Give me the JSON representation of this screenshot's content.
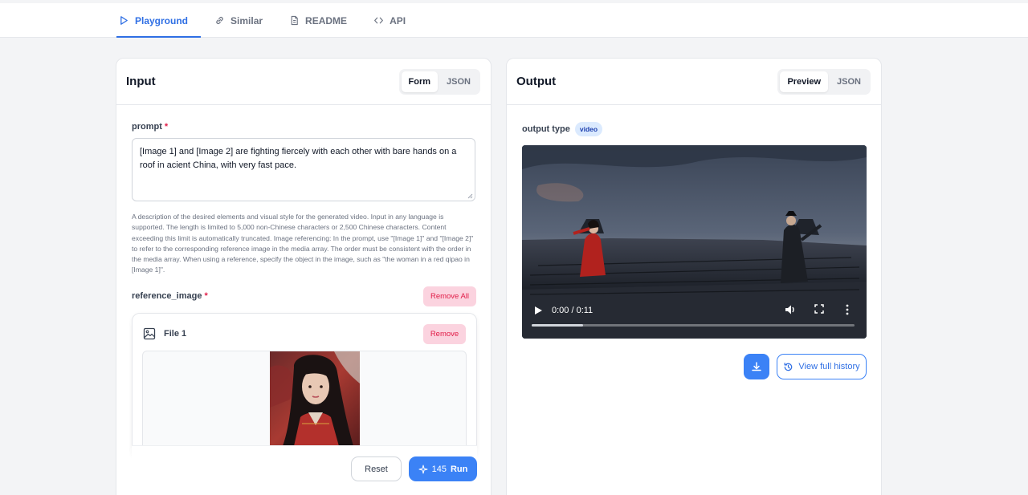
{
  "nav": {
    "tabs": [
      {
        "label": "Playground",
        "icon": "play-icon",
        "active": true
      },
      {
        "label": "Similar",
        "icon": "link-icon"
      },
      {
        "label": "README",
        "icon": "document-icon"
      },
      {
        "label": "API",
        "icon": "code-icon"
      }
    ]
  },
  "input": {
    "title": "Input",
    "toggle": [
      "Form",
      "JSON"
    ],
    "prompt": {
      "label": "prompt",
      "required_mark": "*",
      "value": "[Image 1] and [Image 2] are fighting fiercely with each other with bare hands on a roof in acient China, with very fast pace.",
      "help": "A description of the desired elements and visual style for the generated video. Input in any language is supported. The length is limited to 5,000 non-Chinese characters or 2,500 Chinese characters. Content exceeding this limit is automatically truncated. Image referencing: In the prompt, use \"[Image 1]\" and \"[Image 2]\" to refer to the corresponding reference image in the media array. The order must be consistent with the order in the media array. When using a reference, specify the object in the image, such as \"the woman in a red qipao in [Image 1]\"."
    },
    "reference_image": {
      "label": "reference_image",
      "required_mark": "*",
      "remove_all": "Remove All",
      "file": {
        "name": "File 1",
        "remove": "Remove",
        "icon": "image-icon"
      }
    },
    "actions": {
      "reset": "Reset",
      "run_cost": "145",
      "run": "Run"
    }
  },
  "output": {
    "title": "Output",
    "toggle": [
      "Preview",
      "JSON"
    ],
    "type_label": "output type",
    "type_value": "video",
    "video": {
      "time": "0:00 / 0:11",
      "progress": 0.16
    },
    "history_button": "View full history"
  },
  "colors": {
    "accent": "#3b82f6",
    "danger": "#e11d48",
    "danger_bg": "#fbd3df"
  }
}
